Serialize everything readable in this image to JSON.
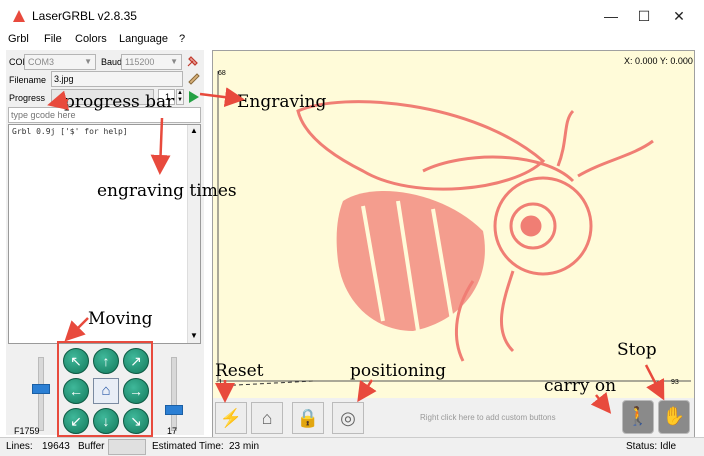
{
  "window": {
    "title": "LaserGRBL v2.8.35",
    "minimize": "—",
    "maximize": "☐",
    "close": "✕"
  },
  "menu": [
    "Grbl",
    "File",
    "Colors",
    "Language",
    "?"
  ],
  "connection": {
    "com_label": "COM",
    "com_value": "COM3",
    "baud_label": "Baud",
    "baud_value": "115200"
  },
  "file": {
    "filename_label": "Filename",
    "filename_value": "3.jpg"
  },
  "progress": {
    "label": "Progress",
    "passes": "1"
  },
  "gcode": {
    "placeholder": "type gcode here"
  },
  "console": {
    "line1": "Grbl 0.9j ['$' for help]"
  },
  "jog": {
    "feed_label": "F1759",
    "step_label": "17"
  },
  "canvas": {
    "coords": "X: 0.000 Y: 0.000",
    "ruler_top": "68",
    "ruler_bottom": "-1",
    "ruler_right": "93",
    "custom_hint": "Right click here to add custom buttons"
  },
  "annotations": {
    "progress_bar": "progress bar",
    "engraving": "Engraving",
    "engraving_times": "engraving times",
    "moving": "Moving",
    "reset": "Reset",
    "positioning": "positioning",
    "stop": "Stop",
    "carry_on": "carry on"
  },
  "status": {
    "lines_label": "Lines:",
    "lines_value": "19643",
    "buffer_label": "Buffer",
    "est_label": "Estimated Time:",
    "est_value": "23 min",
    "status_label": "Status:",
    "status_value": "Idle"
  },
  "colors": {
    "accent": "#e84a3d",
    "canvas_bg": "#fffbd9",
    "jog_green": "#1f9a77"
  }
}
